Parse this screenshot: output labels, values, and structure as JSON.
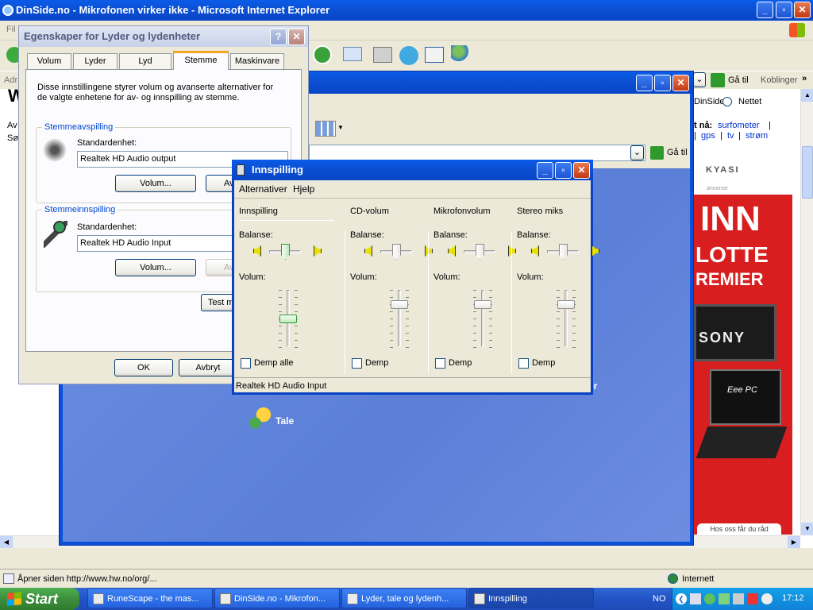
{
  "ie": {
    "title": "DinSide.no - Mikrofonen virker ikke - Microsoft Internet Explorer",
    "menu_first": "Fil",
    "address_label": "Adr",
    "go": "Gå til",
    "links": "Koblinger",
    "status": "Åpner siden http://www.hw.no/org/...",
    "zone": "Internett"
  },
  "page": {
    "frag_w": "W",
    "frag_av": "Av",
    "frag_so": "Sø",
    "dinside": "DinSide",
    "nettet": "Nettet",
    "surf_prefix": "t nå:",
    "surfometer": "surfometer",
    "gps": "gps",
    "tv": "tv",
    "strom": "strøm",
    "kyasit": "KYASI",
    "ad_line1": "INN",
    "ad_line2": "LOTTE",
    "ad_line3": "REMIER",
    "ad_sony": "SONY",
    "ad_eee": "Eee PC",
    "ad_foot": "Hos oss får du råd",
    "annonse": "annonse"
  },
  "cp": {
    "go": "Gå til",
    "item_tale": "Tale",
    "item_manager": "ager"
  },
  "props": {
    "title": "Egenskaper for Lyder og lydenheter",
    "tabs": [
      "Volum",
      "Lyder",
      "Lyd",
      "Stemme",
      "Maskinvare"
    ],
    "desc": "Disse innstillingene styrer volum og avanserte alternativer for de valgte enhetene for av- og innspilling av stemme.",
    "playback_group": "Stemmeavspilling",
    "rec_group": "Stemmeinnspilling",
    "default_label": "Standardenhet:",
    "playback_device": "Realtek HD Audio output",
    "rec_device": "Realtek HD Audio Input",
    "volume_btn": "Volum...",
    "adv_btn": "Av",
    "test_btn": "Test m",
    "ok": "OK",
    "cancel": "Avbryt"
  },
  "mixer": {
    "title": "Innspilling",
    "menu": [
      "Alternativer",
      "Hjelp"
    ],
    "balance_label": "Balanse:",
    "volume_label": "Volum:",
    "status": "Realtek HD Audio Input",
    "channels": [
      {
        "name": "Innspilling",
        "mute": "Demp alle",
        "balance": 0.5,
        "volume": 0.5
      },
      {
        "name": "CD-volum",
        "mute": "Demp",
        "balance": 0.5,
        "volume": 0.75
      },
      {
        "name": "Mikrofonvolum",
        "mute": "Demp",
        "balance": 0.5,
        "volume": 0.75
      },
      {
        "name": "Stereo miks",
        "mute": "Demp",
        "balance": 0.5,
        "volume": 0.75
      }
    ]
  },
  "taskbar": {
    "start": "Start",
    "tasks": [
      "RuneScape - the mas...",
      "DinSide.no - Mikrofon...",
      "Lyder, tale og lydenh...",
      "Innspilling"
    ],
    "lang": "NO",
    "clock": "17:12"
  }
}
